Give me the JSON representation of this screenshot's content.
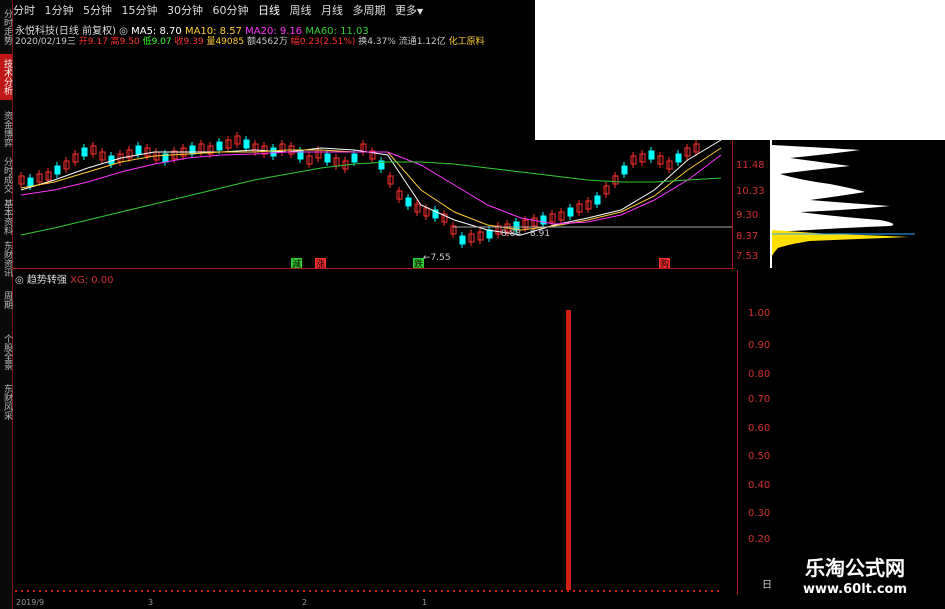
{
  "sidebar": {
    "items": [
      "分时走势",
      "技术分析",
      "资金博弈",
      "分时成交",
      "基本资料",
      "东财资讯",
      "周期",
      "个股全景",
      "东财风采"
    ],
    "active_index": 1
  },
  "toolbar": {
    "tabs": [
      "分时",
      "1分钟",
      "5分钟",
      "15分钟",
      "30分钟",
      "60分钟",
      "日线",
      "周线",
      "月线",
      "多周期",
      "更多"
    ],
    "selected_index": 6,
    "more_icon": "triangle-down-icon"
  },
  "header": {
    "stock": "永悦科技(日线 前复权)",
    "ma5": "MA5: 8.70",
    "ma10": "MA10: 8.57",
    "ma20": "MA20: 9.16",
    "ma60": "MA60: 11.03",
    "date": "2020/02/19三",
    "open": "开9.17",
    "high": "高9.50",
    "low": "低9.07",
    "close": "收9.39",
    "volume": "量49085",
    "amount": "额4562万",
    "change": "幅0.23(2.51%)",
    "turnover": "换4.37%",
    "float": "流通1.12亿",
    "industry": "化工原料"
  },
  "price_axis": {
    "ticks": [
      "11.48",
      "10.33",
      "9.30",
      "8.37",
      "7.53"
    ]
  },
  "annotations": {
    "range": "8.88 - 8.91",
    "low_mark": "←7.55",
    "signals": [
      "減",
      "涨",
      "跌",
      "购"
    ]
  },
  "indicator": {
    "name": "趋势转强",
    "value": "XG: 0.00",
    "ticks": [
      "1.00",
      "0.90",
      "0.80",
      "0.70",
      "0.60",
      "0.50",
      "0.40",
      "0.30",
      "0.20"
    ],
    "spike_value": 1.0,
    "bottom_label": "日"
  },
  "date_axis": {
    "labels": [
      "2019/9",
      "3",
      "2",
      "1"
    ]
  },
  "watermark": {
    "line1": "乐淘公式网",
    "line2": "www.60lt.com"
  },
  "colors": {
    "up": "#ff3030",
    "down": "#00ffff",
    "ma5": "#ffffff",
    "ma10": "#ffcc33",
    "ma20": "#ff33ff",
    "ma60": "#33cc33",
    "axis": "#b01818"
  }
}
